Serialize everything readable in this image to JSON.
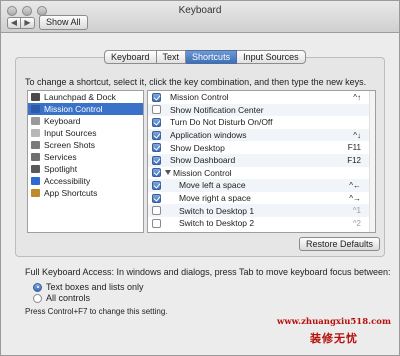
{
  "window": {
    "title": "Keyboard",
    "show_all": "Show All"
  },
  "tabs": [
    {
      "label": "Keyboard",
      "active": false
    },
    {
      "label": "Text",
      "active": false
    },
    {
      "label": "Shortcuts",
      "active": true
    },
    {
      "label": "Input Sources",
      "active": false
    }
  ],
  "instructions": "To change a shortcut, select it, click the key combination, and then type the new keys.",
  "categories": [
    {
      "label": "Launchpad & Dock",
      "icon": "launchpad-icon",
      "color": "#4a4a4a",
      "selected": false
    },
    {
      "label": "Mission Control",
      "icon": "mission-control-icon",
      "color": "#2d5aa8",
      "selected": true
    },
    {
      "label": "Keyboard",
      "icon": "keyboard-icon",
      "color": "#9a9a9a",
      "selected": false
    },
    {
      "label": "Input Sources",
      "icon": "input-sources-icon",
      "color": "#b8b8b8",
      "selected": false
    },
    {
      "label": "Screen Shots",
      "icon": "screenshot-icon",
      "color": "#7a7a7a",
      "selected": false
    },
    {
      "label": "Services",
      "icon": "gear-icon",
      "color": "#6f6f6f",
      "selected": false
    },
    {
      "label": "Spotlight",
      "icon": "spotlight-icon",
      "color": "#5a5a5a",
      "selected": false
    },
    {
      "label": "Accessibility",
      "icon": "accessibility-icon",
      "color": "#2f6ad0",
      "selected": false
    },
    {
      "label": "App Shortcuts",
      "icon": "app-shortcuts-icon",
      "color": "#c08a2a",
      "selected": false
    }
  ],
  "shortcuts": [
    {
      "checked": true,
      "name": "Mission Control",
      "key": "^↑",
      "indent": false,
      "group": false,
      "dim": false
    },
    {
      "checked": false,
      "name": "Show Notification Center",
      "key": "",
      "indent": false,
      "group": false,
      "dim": false
    },
    {
      "checked": true,
      "name": "Turn Do Not Disturb On/Off",
      "key": "",
      "indent": false,
      "group": false,
      "dim": false
    },
    {
      "checked": true,
      "name": "Application windows",
      "key": "^↓",
      "indent": false,
      "group": false,
      "dim": false
    },
    {
      "checked": true,
      "name": "Show Desktop",
      "key": "F11",
      "indent": false,
      "group": false,
      "dim": false
    },
    {
      "checked": true,
      "name": "Show Dashboard",
      "key": "F12",
      "indent": false,
      "group": false,
      "dim": false
    },
    {
      "checked": true,
      "name": "Mission Control",
      "key": "",
      "indent": false,
      "group": true,
      "dim": false
    },
    {
      "checked": true,
      "name": "Move left a space",
      "key": "^←",
      "indent": true,
      "group": false,
      "dim": false
    },
    {
      "checked": true,
      "name": "Move right a space",
      "key": "^→",
      "indent": true,
      "group": false,
      "dim": false
    },
    {
      "checked": false,
      "name": "Switch to Desktop 1",
      "key": "^1",
      "indent": true,
      "group": false,
      "dim": true
    },
    {
      "checked": false,
      "name": "Switch to Desktop 2",
      "key": "^2",
      "indent": true,
      "group": false,
      "dim": true
    }
  ],
  "restore_defaults": "Restore Defaults",
  "full_keyboard_access": "Full Keyboard Access: In windows and dialogs, press Tab to move keyboard focus between:",
  "radio_options": [
    {
      "label": "Text boxes and lists only",
      "selected": true
    },
    {
      "label": "All controls",
      "selected": false
    }
  ],
  "hint": "Press Control+F7 to change this setting.",
  "watermark": {
    "url": "www.zhuangxiu518.com",
    "text": "装修无忧"
  }
}
